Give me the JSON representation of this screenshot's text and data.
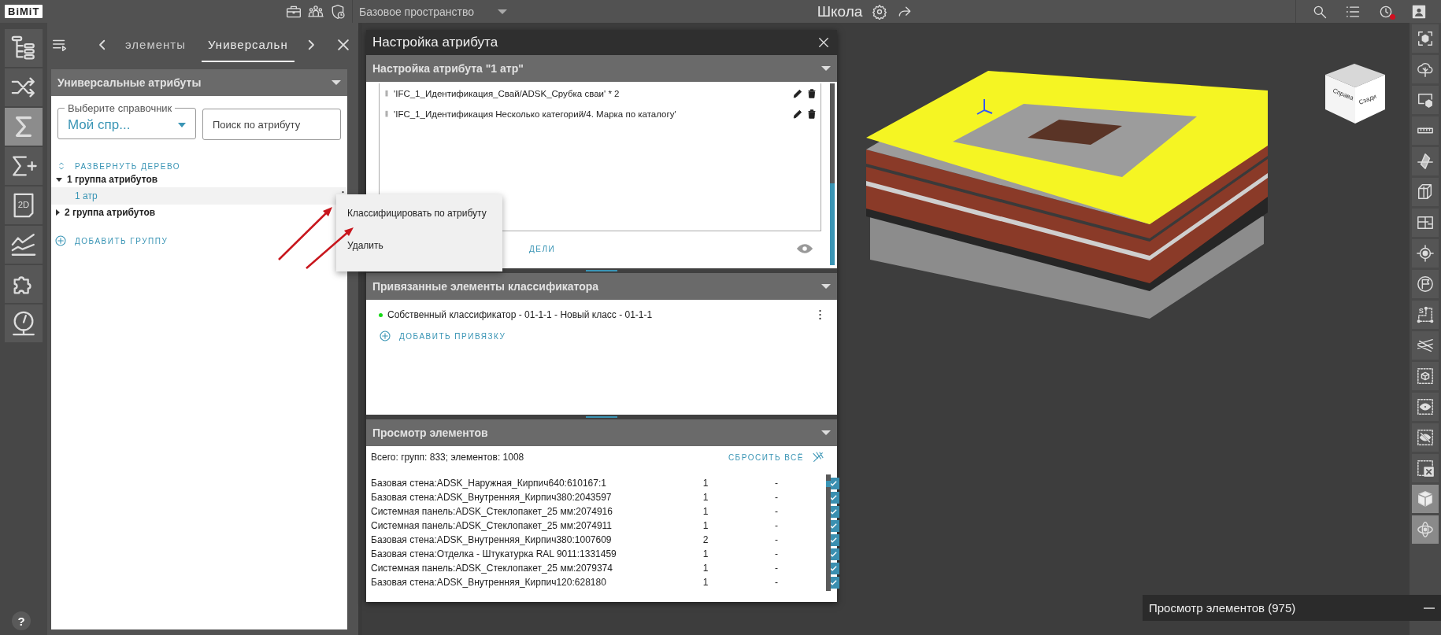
{
  "top_bar": {
    "logo": "BiMiT",
    "workspace": "Базовое пространство",
    "project": "Школа",
    "notification": true
  },
  "left_toolbar": [
    {
      "selected": false
    },
    {
      "selected": false
    },
    {
      "selected": true
    },
    {
      "selected": false
    },
    {
      "selected": false,
      "label": "2D"
    },
    {
      "selected": false
    },
    {
      "selected": false
    },
    {
      "selected": false
    }
  ],
  "help": "?",
  "panel": {
    "tabs": [
      {
        "label": "элементы",
        "selected": false
      },
      {
        "label": "Универсальн",
        "selected": true
      }
    ],
    "section_title": "Универсальные атрибуты",
    "reference": {
      "label": "Выберите справочник",
      "value": "Мой спр..."
    },
    "search": {
      "placeholder": "Поиск по атрибуту"
    },
    "expand_tree": "РАЗВЕРНУТЬ ДЕРЕВО",
    "tree": [
      {
        "label": "1 группа атрибутов",
        "expanded": true,
        "children": [
          {
            "label": "1 атр",
            "selected": true
          }
        ]
      },
      {
        "label": "2 группа атрибутов",
        "expanded": false
      }
    ],
    "add_group": "ДОБАВИТЬ ГРУППУ"
  },
  "context_menu": [
    "Классифицировать по атрибуту",
    "Удалить"
  ],
  "dialog": {
    "title": "Настройка атрибута",
    "formula": {
      "title": "Настройка атрибута \"1 атр\"",
      "terms": [
        "'IFC_1_Идентификация_Свай/ADSK_Срубка сваи' * 2",
        "'IFC_1_Идентификация Несколько категорий/4. Марка по каталогу'"
      ],
      "link": "ДЕЛИ"
    },
    "bindings": {
      "title": "Привязанные элементы классификатора",
      "items": [
        {
          "label": "Собственный классификатор - 01-1-1 - Новый класс - 01-1-1",
          "color": "#16d916"
        }
      ],
      "add": "ДОБАВИТЬ ПРИВЯЗКУ"
    },
    "elements": {
      "title": "Просмотр элементов",
      "summary": "Всего: групп: 833; элементов: 1008",
      "reset": "СБРОСИТЬ ВСЁ",
      "rows": [
        {
          "name": "Базовая стена:ADSK_Наружная_Кирпич640:610167:1",
          "count": "1",
          "column_3": "-",
          "checked": true
        },
        {
          "name": "Базовая стена:ADSK_Внутренняя_Кирпич380:2043597",
          "count": "1",
          "column_3": "-",
          "checked": true
        },
        {
          "name": "Системная панель:ADSK_Стеклопакет_25 мм:2074916",
          "count": "1",
          "column_3": "-",
          "checked": true
        },
        {
          "name": "Системная панель:ADSK_Стеклопакет_25 мм:2074911",
          "count": "1",
          "column_3": "-",
          "checked": true
        },
        {
          "name": "Базовая стена:ADSK_Внутренняя_Кирпич380:1007609",
          "count": "2",
          "column_3": "-",
          "checked": true
        },
        {
          "name": "Базовая стена:Отделка - Штукатурка RAL 9011:1331459",
          "count": "1",
          "column_3": "-",
          "checked": true
        },
        {
          "name": "Системная панель:ADSK_Стеклопакет_25 мм:2079374",
          "count": "1",
          "column_3": "-",
          "checked": true
        },
        {
          "name": "Базовая стена:ADSK_Внутренняя_Кирпич120:628180",
          "count": "1",
          "column_3": "-",
          "checked": true
        }
      ]
    }
  },
  "viewport": {
    "view_cube": [
      "Справа",
      "Сзади"
    ]
  },
  "toast": "Просмотр элементов (975)",
  "right_toolbar": [
    {
      "selected": false
    },
    {
      "selected": false
    },
    {
      "selected": false
    },
    {
      "selected": false
    },
    {
      "selected": false
    },
    {
      "selected": false
    },
    {
      "selected": false
    },
    {
      "selected": false
    },
    {
      "selected": false
    },
    {
      "selected": false,
      "label": "S"
    },
    {
      "selected": false
    },
    {
      "selected": false
    },
    {
      "selected": false
    },
    {
      "selected": false
    },
    {
      "selected": false
    },
    {
      "selected": true
    },
    {
      "selected": true
    }
  ]
}
